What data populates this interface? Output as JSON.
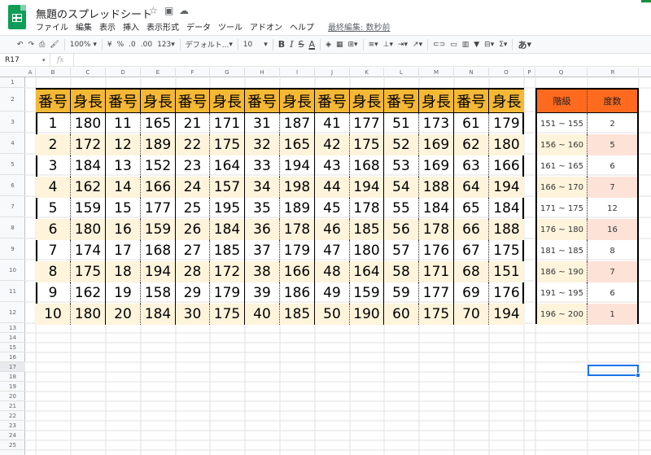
{
  "header": {
    "doc_title": "無題のスプレッドシート",
    "menus": [
      "ファイル",
      "編集",
      "表示",
      "挿入",
      "表示形式",
      "データ",
      "ツール",
      "アドオン",
      "ヘルプ"
    ],
    "last_edit": "最終編集: 数秒前"
  },
  "toolbar": {
    "zoom": "100%",
    "currency": "¥",
    "percent": "%",
    "decimal_less": ".0",
    "decimal_more": ".00",
    "number_format": "123",
    "font": "デフォルト...",
    "font_size": "10",
    "bold": "B",
    "italic": "I",
    "strike": "S",
    "text_color": "A",
    "more": "あ"
  },
  "formula_bar": {
    "name_box": "R17",
    "fx": "fx",
    "value": ""
  },
  "columns": [
    "A",
    "B",
    "C",
    "D",
    "E",
    "F",
    "G",
    "H",
    "I",
    "J",
    "K",
    "L",
    "M",
    "N",
    "O",
    "P",
    "Q",
    "R"
  ],
  "rows": [
    "1",
    "2",
    "3",
    "4",
    "5",
    "6",
    "7",
    "8",
    "9",
    "10",
    "11",
    "12",
    "13",
    "14",
    "15",
    "16",
    "17",
    "18",
    "19",
    "20",
    "21",
    "22",
    "23",
    "24",
    "25"
  ],
  "main_table": {
    "headers": [
      "番号",
      "身長",
      "番号",
      "身長",
      "番号",
      "身長",
      "番号",
      "身長",
      "番号",
      "身長",
      "番号",
      "身長",
      "番号",
      "身長"
    ],
    "rows": [
      [
        "1",
        "180",
        "11",
        "165",
        "21",
        "171",
        "31",
        "187",
        "41",
        "177",
        "51",
        "173",
        "61",
        "179"
      ],
      [
        "2",
        "172",
        "12",
        "189",
        "22",
        "175",
        "32",
        "165",
        "42",
        "175",
        "52",
        "169",
        "62",
        "180"
      ],
      [
        "3",
        "184",
        "13",
        "152",
        "23",
        "164",
        "33",
        "194",
        "43",
        "168",
        "53",
        "169",
        "63",
        "166"
      ],
      [
        "4",
        "162",
        "14",
        "166",
        "24",
        "157",
        "34",
        "198",
        "44",
        "194",
        "54",
        "188",
        "64",
        "194"
      ],
      [
        "5",
        "159",
        "15",
        "177",
        "25",
        "195",
        "35",
        "189",
        "45",
        "178",
        "55",
        "184",
        "65",
        "184"
      ],
      [
        "6",
        "180",
        "16",
        "159",
        "26",
        "184",
        "36",
        "178",
        "46",
        "185",
        "56",
        "178",
        "66",
        "188"
      ],
      [
        "7",
        "174",
        "17",
        "168",
        "27",
        "185",
        "37",
        "179",
        "47",
        "180",
        "57",
        "176",
        "67",
        "175"
      ],
      [
        "8",
        "175",
        "18",
        "194",
        "28",
        "172",
        "38",
        "166",
        "48",
        "164",
        "58",
        "171",
        "68",
        "151"
      ],
      [
        "9",
        "162",
        "19",
        "158",
        "29",
        "179",
        "39",
        "186",
        "49",
        "159",
        "59",
        "177",
        "69",
        "176"
      ],
      [
        "10",
        "180",
        "20",
        "184",
        "30",
        "175",
        "40",
        "185",
        "50",
        "190",
        "60",
        "175",
        "70",
        "194"
      ]
    ]
  },
  "freq_table": {
    "headers": [
      "階級",
      "度数"
    ],
    "rows": [
      [
        "151 ~ 155",
        "2"
      ],
      [
        "156 ~ 160",
        "5"
      ],
      [
        "161 ~ 165",
        "6"
      ],
      [
        "166 ~ 170",
        "7"
      ],
      [
        "171 ~ 175",
        "12"
      ],
      [
        "176 ~ 180",
        "16"
      ],
      [
        "181 ~ 185",
        "8"
      ],
      [
        "186 ~ 190",
        "7"
      ],
      [
        "191 ~ 195",
        "6"
      ],
      [
        "196 ~ 200",
        "1"
      ]
    ]
  },
  "colors": {
    "header_fill": "#f5b835",
    "band_fill": "#fef4dc",
    "freq_header_fill": "#ff6a1e",
    "freq_band_fill": "#fde2d8",
    "brand_green": "#0f9d58"
  }
}
